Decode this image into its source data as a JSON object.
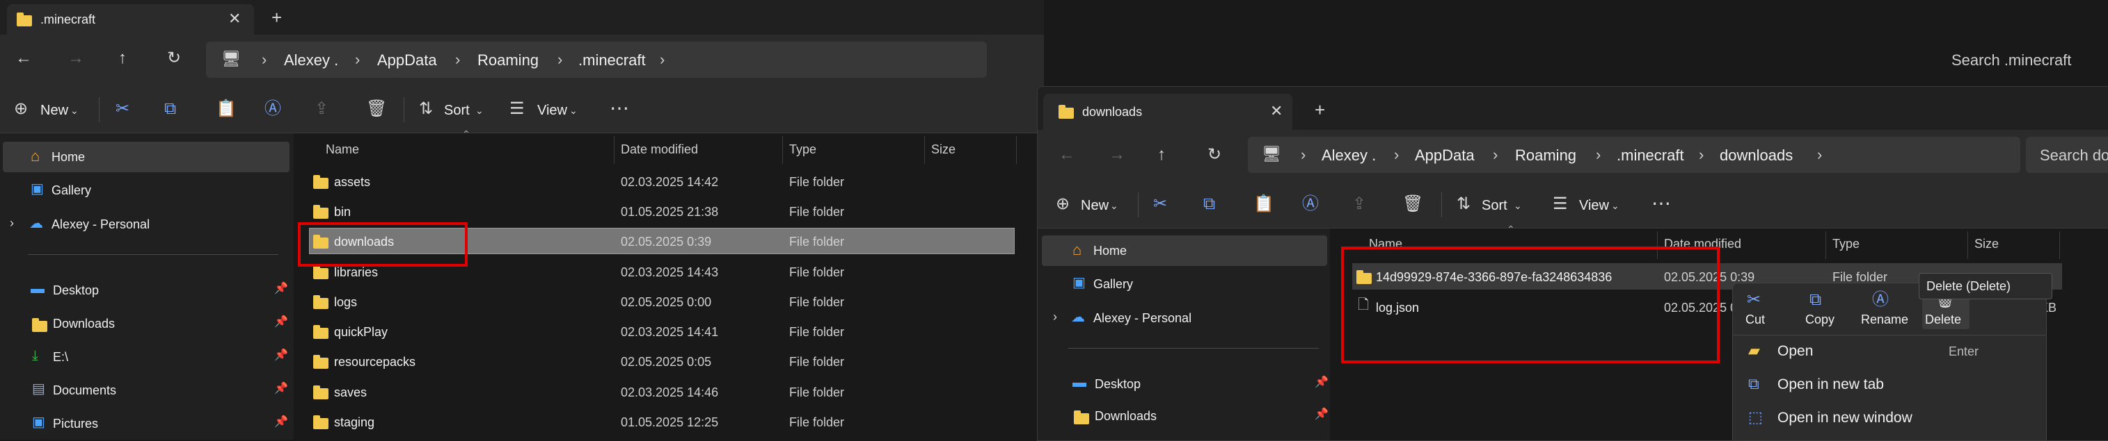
{
  "left": {
    "tab_title": ".minecraft",
    "breadcrumb": [
      "Alexey .",
      "AppData",
      "Roaming",
      ".minecraft"
    ],
    "search_placeholder": "Search .minecraft",
    "cmd": {
      "new": "New",
      "sort": "Sort",
      "view": "View"
    },
    "sidebar": {
      "home": "Home",
      "gallery": "Gallery",
      "personal": "Alexey - Personal",
      "desktop": "Desktop",
      "downloads": "Downloads",
      "e": "E:\\",
      "documents": "Documents",
      "pictures": "Pictures"
    },
    "columns": {
      "name": "Name",
      "date": "Date modified",
      "type": "Type",
      "size": "Size"
    },
    "rows": [
      {
        "name": "assets",
        "date": "02.03.2025 14:42",
        "type": "File folder"
      },
      {
        "name": "bin",
        "date": "01.05.2025 21:38",
        "type": "File folder"
      },
      {
        "name": "downloads",
        "date": "02.05.2025 0:39",
        "type": "File folder"
      },
      {
        "name": "libraries",
        "date": "02.03.2025 14:43",
        "type": "File folder"
      },
      {
        "name": "logs",
        "date": "02.05.2025 0:00",
        "type": "File folder"
      },
      {
        "name": "quickPlay",
        "date": "02.03.2025 14:41",
        "type": "File folder"
      },
      {
        "name": "resourcepacks",
        "date": "02.05.2025 0:05",
        "type": "File folder"
      },
      {
        "name": "saves",
        "date": "02.03.2025 14:46",
        "type": "File folder"
      },
      {
        "name": "staging",
        "date": "01.05.2025 12:25",
        "type": "File folder"
      }
    ]
  },
  "right": {
    "tab_title": "downloads",
    "breadcrumb": [
      "Alexey .",
      "AppData",
      "Roaming",
      ".minecraft",
      "downloads"
    ],
    "search_placeholder": "Search dow",
    "cmd": {
      "new": "New",
      "sort": "Sort",
      "view": "View"
    },
    "sidebar": {
      "home": "Home",
      "gallery": "Gallery",
      "personal": "Alexey - Personal",
      "desktop": "Desktop",
      "downloads": "Downloads"
    },
    "columns": {
      "name": "Name",
      "date": "Date modified",
      "type": "Type",
      "size": "Size"
    },
    "rows": [
      {
        "name": "14d99929-874e-3366-897e-fa3248634836",
        "date": "02.05.2025 0:39",
        "type": "File folder",
        "size": ""
      },
      {
        "name": "log.json",
        "date": "02.05.2025 0",
        "type": "",
        "size": "KB"
      }
    ]
  },
  "context_menu": {
    "tooltip": "Delete (Delete)",
    "actions": [
      "Cut",
      "Copy",
      "Rename",
      "Delete"
    ],
    "items": [
      {
        "label": "Open",
        "shortcut": "Enter"
      },
      {
        "label": "Open in new tab",
        "shortcut": ""
      },
      {
        "label": "Open in new window",
        "shortcut": ""
      }
    ]
  }
}
